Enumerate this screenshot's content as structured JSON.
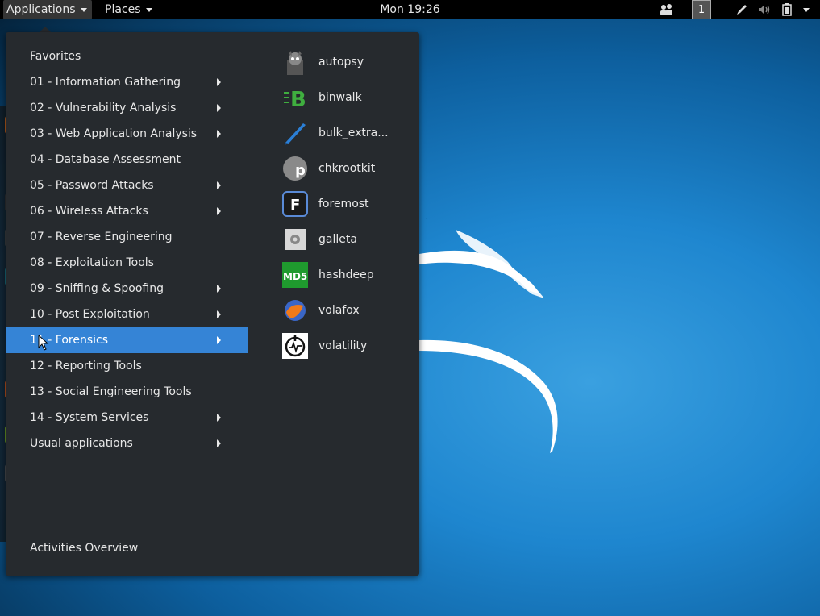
{
  "topbar": {
    "applications": "Applications",
    "places": "Places",
    "clock": "Mon 19:26",
    "workspace": "1",
    "icons": [
      "accessibility-people-icon",
      "pen-icon",
      "volume-icon",
      "battery-icon",
      "system-menu-caret-icon"
    ]
  },
  "menu": {
    "categories": [
      {
        "label": "Favorites",
        "submenu": false
      },
      {
        "label": "01 - Information Gathering",
        "submenu": true
      },
      {
        "label": "02 - Vulnerability Analysis",
        "submenu": true
      },
      {
        "label": "03 - Web Application Analysis",
        "submenu": true
      },
      {
        "label": "04 - Database Assessment",
        "submenu": false
      },
      {
        "label": "05 - Password Attacks",
        "submenu": true
      },
      {
        "label": "06 - Wireless Attacks",
        "submenu": true
      },
      {
        "label": "07 - Reverse Engineering",
        "submenu": false
      },
      {
        "label": "08 - Exploitation Tools",
        "submenu": false
      },
      {
        "label": "09 - Sniffing & Spoofing",
        "submenu": true
      },
      {
        "label": "10 - Post Exploitation",
        "submenu": true
      },
      {
        "label": "11 - Forensics",
        "submenu": true,
        "selected": true
      },
      {
        "label": "12 - Reporting Tools",
        "submenu": false
      },
      {
        "label": "13 - Social Engineering Tools",
        "submenu": false
      },
      {
        "label": "14 - System Services",
        "submenu": true
      },
      {
        "label": "Usual applications",
        "submenu": true
      }
    ],
    "activities": "Activities Overview",
    "apps": [
      {
        "label": "autopsy",
        "icon": "autopsy-icon"
      },
      {
        "label": "binwalk",
        "icon": "binwalk-icon"
      },
      {
        "label": "bulk_extra...",
        "icon": "bulk-extractor-icon"
      },
      {
        "label": "chkrootkit",
        "icon": "chkrootkit-icon"
      },
      {
        "label": "foremost",
        "icon": "foremost-icon"
      },
      {
        "label": "galleta",
        "icon": "galleta-icon"
      },
      {
        "label": "hashdeep",
        "icon": "hashdeep-icon"
      },
      {
        "label": "volafox",
        "icon": "volafox-icon"
      },
      {
        "label": "volatility",
        "icon": "volatility-icon"
      }
    ]
  },
  "colors": {
    "menu_bg": "#262a2e",
    "selected": "#3584d6",
    "topbar": "#000000"
  }
}
